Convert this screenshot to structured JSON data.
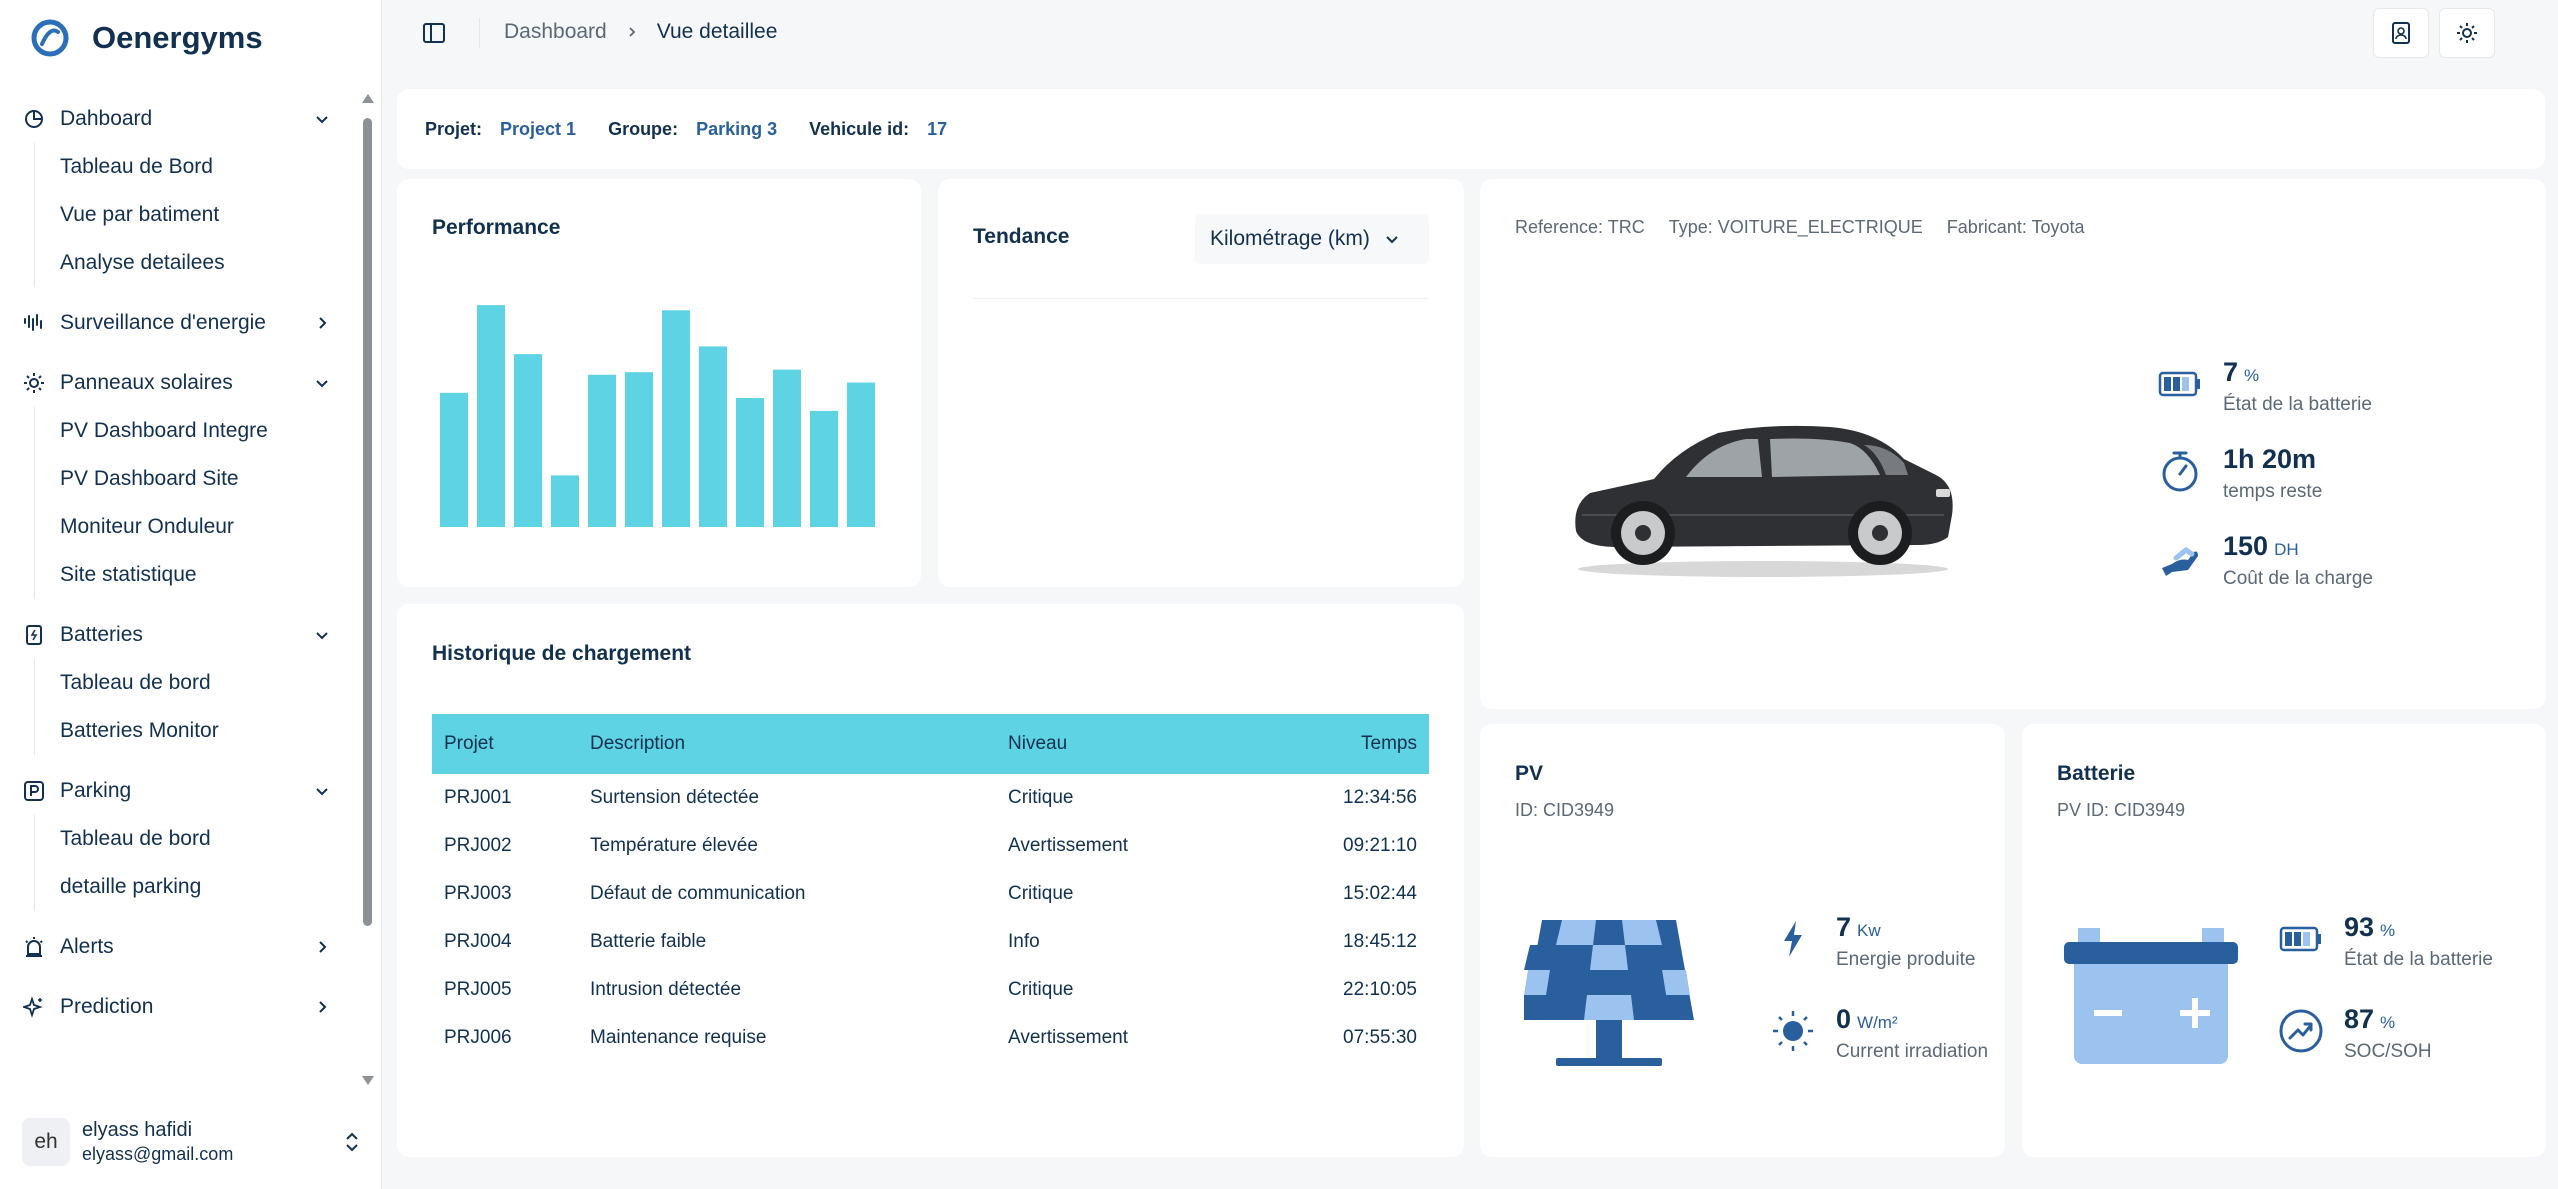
{
  "brand": {
    "name": "Oenergyms"
  },
  "sidebar": {
    "groups": [
      {
        "label": "Dahboard",
        "expanded": true,
        "icon": "pie-chart-icon",
        "items": [
          "Tableau de Bord",
          "Vue par batiment",
          "Analyse detailees"
        ]
      },
      {
        "label": "Surveillance d'energie",
        "expanded": false,
        "icon": "waveform-icon",
        "items": []
      },
      {
        "label": "Panneaux solaires",
        "expanded": true,
        "icon": "sun-icon",
        "items": [
          "PV Dashboard Integre",
          "PV Dashboard Site",
          "Moniteur Onduleur",
          "Site statistique"
        ]
      },
      {
        "label": "Batteries",
        "expanded": true,
        "icon": "battery-icon",
        "items": [
          "Tableau de bord",
          "Batteries Monitor"
        ]
      },
      {
        "label": "Parking",
        "expanded": true,
        "icon": "parking-icon",
        "items": [
          "Tableau de bord",
          "detaille parking"
        ]
      },
      {
        "label": "Alerts",
        "expanded": false,
        "icon": "siren-icon",
        "items": []
      },
      {
        "label": "Prediction",
        "expanded": false,
        "icon": "sparkles-icon",
        "items": []
      }
    ]
  },
  "user": {
    "initials": "eh",
    "name": "elyass hafidi",
    "email": "elyass@gmail.com"
  },
  "header": {
    "crumb1": "Dashboard",
    "crumb2": "Vue detaillee"
  },
  "info": {
    "projet_key": "Projet:",
    "projet_val": "Project 1",
    "groupe_key": "Groupe:",
    "groupe_val": "Parking 3",
    "vehicule_key": "Vehicule id:",
    "vehicule_val": "17"
  },
  "performance": {
    "title": "Performance"
  },
  "chart_data": {
    "type": "bar",
    "values": [
      52,
      86,
      67,
      20,
      59,
      60,
      84,
      70,
      50,
      61,
      45,
      56
    ],
    "ylim": [
      0,
      100
    ],
    "color": "#5dd3e4"
  },
  "tendance": {
    "title": "Tendance",
    "selected": "Kilométrage (km)"
  },
  "vehicle": {
    "reference": "Reference: TRC",
    "type": "Type: VOITURE_ELECTRIQUE",
    "fabricant": "Fabricant: Toyota",
    "stats": [
      {
        "value": "7",
        "unit": "%",
        "label": "État de la batterie",
        "icon": "battery-icon"
      },
      {
        "value": "1h 20m",
        "unit": "",
        "label": "temps reste",
        "icon": "timer-icon"
      },
      {
        "value": "150",
        "unit": "DH",
        "label": "Coût de la charge",
        "icon": "hand-coins-icon"
      }
    ]
  },
  "history": {
    "title": "Historique de chargement",
    "columns": [
      "Projet",
      "Description",
      "Niveau",
      "Temps"
    ],
    "rows": [
      [
        "PRJ001",
        "Surtension détectée",
        "Critique",
        "12:34:56"
      ],
      [
        "PRJ002",
        "Température élevée",
        "Avertissement",
        "09:21:10"
      ],
      [
        "PRJ003",
        "Défaut de communication",
        "Critique",
        "15:02:44"
      ],
      [
        "PRJ004",
        "Batterie faible",
        "Info",
        "18:45:12"
      ],
      [
        "PRJ005",
        "Intrusion détectée",
        "Critique",
        "22:10:05"
      ],
      [
        "PRJ006",
        "Maintenance requise",
        "Avertissement",
        "07:55:30"
      ]
    ]
  },
  "pv": {
    "title": "PV",
    "id": "ID: CID3949",
    "stats": [
      {
        "value": "7",
        "unit": "Kw",
        "label": "Energie produite",
        "icon": "bolt-icon"
      },
      {
        "value": "0",
        "unit": "W/m²",
        "label": "Current irradiation",
        "icon": "sun-icon"
      }
    ]
  },
  "batterie": {
    "title": "Batterie",
    "id": "PV ID: CID3949",
    "stats": [
      {
        "value": "93",
        "unit": "%",
        "label": "État de la batterie",
        "icon": "battery-icon"
      },
      {
        "value": "87",
        "unit": "%",
        "label": "SOC/SOH",
        "icon": "trend-up-icon"
      }
    ]
  },
  "colors": {
    "accent": "#5dd3e4",
    "navy": "#12304f",
    "blue": "#2a5f9e"
  }
}
